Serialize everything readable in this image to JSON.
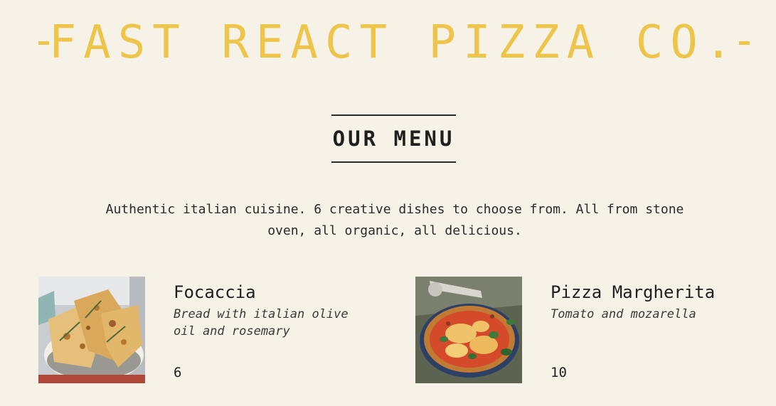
{
  "header": {
    "title": "FAST REACT PIZZA CO."
  },
  "menu": {
    "heading": "OUR MENU",
    "intro": "Authentic italian cuisine. 6 creative dishes to choose from. All from stone oven, all organic, all delicious."
  },
  "pizzas": [
    {
      "name": "Focaccia",
      "ingredients": "Bread with italian olive oil and rosemary",
      "price": "6",
      "image": "focaccia-photo"
    },
    {
      "name": "Pizza Margherita",
      "ingredients": "Tomato and mozarella",
      "price": "10",
      "image": "pizza-margherita-photo"
    }
  ],
  "colors": {
    "background": "#f6f2e8",
    "accent": "#edc54a",
    "text": "#2a2a28"
  }
}
